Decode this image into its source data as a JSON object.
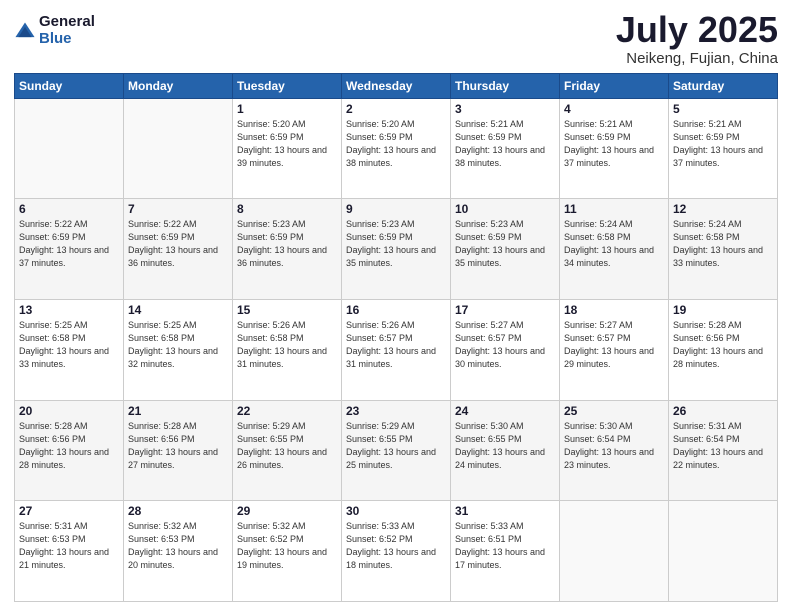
{
  "logo": {
    "general": "General",
    "blue": "Blue"
  },
  "title": "July 2025",
  "subtitle": "Neikeng, Fujian, China",
  "days_of_week": [
    "Sunday",
    "Monday",
    "Tuesday",
    "Wednesday",
    "Thursday",
    "Friday",
    "Saturday"
  ],
  "weeks": [
    [
      {
        "day": "",
        "sunrise": "",
        "sunset": "",
        "daylight": ""
      },
      {
        "day": "",
        "sunrise": "",
        "sunset": "",
        "daylight": ""
      },
      {
        "day": "1",
        "sunrise": "Sunrise: 5:20 AM",
        "sunset": "Sunset: 6:59 PM",
        "daylight": "Daylight: 13 hours and 39 minutes."
      },
      {
        "day": "2",
        "sunrise": "Sunrise: 5:20 AM",
        "sunset": "Sunset: 6:59 PM",
        "daylight": "Daylight: 13 hours and 38 minutes."
      },
      {
        "day": "3",
        "sunrise": "Sunrise: 5:21 AM",
        "sunset": "Sunset: 6:59 PM",
        "daylight": "Daylight: 13 hours and 38 minutes."
      },
      {
        "day": "4",
        "sunrise": "Sunrise: 5:21 AM",
        "sunset": "Sunset: 6:59 PM",
        "daylight": "Daylight: 13 hours and 37 minutes."
      },
      {
        "day": "5",
        "sunrise": "Sunrise: 5:21 AM",
        "sunset": "Sunset: 6:59 PM",
        "daylight": "Daylight: 13 hours and 37 minutes."
      }
    ],
    [
      {
        "day": "6",
        "sunrise": "Sunrise: 5:22 AM",
        "sunset": "Sunset: 6:59 PM",
        "daylight": "Daylight: 13 hours and 37 minutes."
      },
      {
        "day": "7",
        "sunrise": "Sunrise: 5:22 AM",
        "sunset": "Sunset: 6:59 PM",
        "daylight": "Daylight: 13 hours and 36 minutes."
      },
      {
        "day": "8",
        "sunrise": "Sunrise: 5:23 AM",
        "sunset": "Sunset: 6:59 PM",
        "daylight": "Daylight: 13 hours and 36 minutes."
      },
      {
        "day": "9",
        "sunrise": "Sunrise: 5:23 AM",
        "sunset": "Sunset: 6:59 PM",
        "daylight": "Daylight: 13 hours and 35 minutes."
      },
      {
        "day": "10",
        "sunrise": "Sunrise: 5:23 AM",
        "sunset": "Sunset: 6:59 PM",
        "daylight": "Daylight: 13 hours and 35 minutes."
      },
      {
        "day": "11",
        "sunrise": "Sunrise: 5:24 AM",
        "sunset": "Sunset: 6:58 PM",
        "daylight": "Daylight: 13 hours and 34 minutes."
      },
      {
        "day": "12",
        "sunrise": "Sunrise: 5:24 AM",
        "sunset": "Sunset: 6:58 PM",
        "daylight": "Daylight: 13 hours and 33 minutes."
      }
    ],
    [
      {
        "day": "13",
        "sunrise": "Sunrise: 5:25 AM",
        "sunset": "Sunset: 6:58 PM",
        "daylight": "Daylight: 13 hours and 33 minutes."
      },
      {
        "day": "14",
        "sunrise": "Sunrise: 5:25 AM",
        "sunset": "Sunset: 6:58 PM",
        "daylight": "Daylight: 13 hours and 32 minutes."
      },
      {
        "day": "15",
        "sunrise": "Sunrise: 5:26 AM",
        "sunset": "Sunset: 6:58 PM",
        "daylight": "Daylight: 13 hours and 31 minutes."
      },
      {
        "day": "16",
        "sunrise": "Sunrise: 5:26 AM",
        "sunset": "Sunset: 6:57 PM",
        "daylight": "Daylight: 13 hours and 31 minutes."
      },
      {
        "day": "17",
        "sunrise": "Sunrise: 5:27 AM",
        "sunset": "Sunset: 6:57 PM",
        "daylight": "Daylight: 13 hours and 30 minutes."
      },
      {
        "day": "18",
        "sunrise": "Sunrise: 5:27 AM",
        "sunset": "Sunset: 6:57 PM",
        "daylight": "Daylight: 13 hours and 29 minutes."
      },
      {
        "day": "19",
        "sunrise": "Sunrise: 5:28 AM",
        "sunset": "Sunset: 6:56 PM",
        "daylight": "Daylight: 13 hours and 28 minutes."
      }
    ],
    [
      {
        "day": "20",
        "sunrise": "Sunrise: 5:28 AM",
        "sunset": "Sunset: 6:56 PM",
        "daylight": "Daylight: 13 hours and 28 minutes."
      },
      {
        "day": "21",
        "sunrise": "Sunrise: 5:28 AM",
        "sunset": "Sunset: 6:56 PM",
        "daylight": "Daylight: 13 hours and 27 minutes."
      },
      {
        "day": "22",
        "sunrise": "Sunrise: 5:29 AM",
        "sunset": "Sunset: 6:55 PM",
        "daylight": "Daylight: 13 hours and 26 minutes."
      },
      {
        "day": "23",
        "sunrise": "Sunrise: 5:29 AM",
        "sunset": "Sunset: 6:55 PM",
        "daylight": "Daylight: 13 hours and 25 minutes."
      },
      {
        "day": "24",
        "sunrise": "Sunrise: 5:30 AM",
        "sunset": "Sunset: 6:55 PM",
        "daylight": "Daylight: 13 hours and 24 minutes."
      },
      {
        "day": "25",
        "sunrise": "Sunrise: 5:30 AM",
        "sunset": "Sunset: 6:54 PM",
        "daylight": "Daylight: 13 hours and 23 minutes."
      },
      {
        "day": "26",
        "sunrise": "Sunrise: 5:31 AM",
        "sunset": "Sunset: 6:54 PM",
        "daylight": "Daylight: 13 hours and 22 minutes."
      }
    ],
    [
      {
        "day": "27",
        "sunrise": "Sunrise: 5:31 AM",
        "sunset": "Sunset: 6:53 PM",
        "daylight": "Daylight: 13 hours and 21 minutes."
      },
      {
        "day": "28",
        "sunrise": "Sunrise: 5:32 AM",
        "sunset": "Sunset: 6:53 PM",
        "daylight": "Daylight: 13 hours and 20 minutes."
      },
      {
        "day": "29",
        "sunrise": "Sunrise: 5:32 AM",
        "sunset": "Sunset: 6:52 PM",
        "daylight": "Daylight: 13 hours and 19 minutes."
      },
      {
        "day": "30",
        "sunrise": "Sunrise: 5:33 AM",
        "sunset": "Sunset: 6:52 PM",
        "daylight": "Daylight: 13 hours and 18 minutes."
      },
      {
        "day": "31",
        "sunrise": "Sunrise: 5:33 AM",
        "sunset": "Sunset: 6:51 PM",
        "daylight": "Daylight: 13 hours and 17 minutes."
      },
      {
        "day": "",
        "sunrise": "",
        "sunset": "",
        "daylight": ""
      },
      {
        "day": "",
        "sunrise": "",
        "sunset": "",
        "daylight": ""
      }
    ]
  ]
}
